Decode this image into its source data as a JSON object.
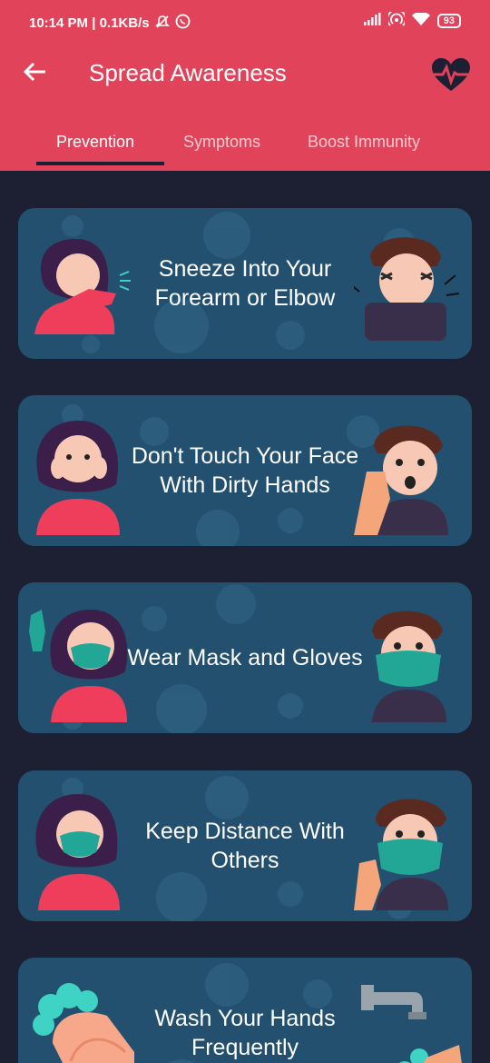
{
  "status": {
    "time_speed": "10:14 PM | 0.1KB/s",
    "battery": "93"
  },
  "header": {
    "title": "Spread Awareness"
  },
  "tabs": [
    {
      "label": "Prevention"
    },
    {
      "label": "Symptoms"
    },
    {
      "label": "Boost Immunity"
    }
  ],
  "cards": [
    {
      "text": "Sneeze Into Your Forearm or Elbow"
    },
    {
      "text": "Don't Touch Your Face With Dirty Hands"
    },
    {
      "text": "Wear Mask and Gloves"
    },
    {
      "text": "Keep Distance With Others"
    },
    {
      "text": "Wash Your Hands Frequently"
    }
  ],
  "colors": {
    "primary": "#e0435a",
    "background": "#1d1f33",
    "card": "#23506e"
  }
}
